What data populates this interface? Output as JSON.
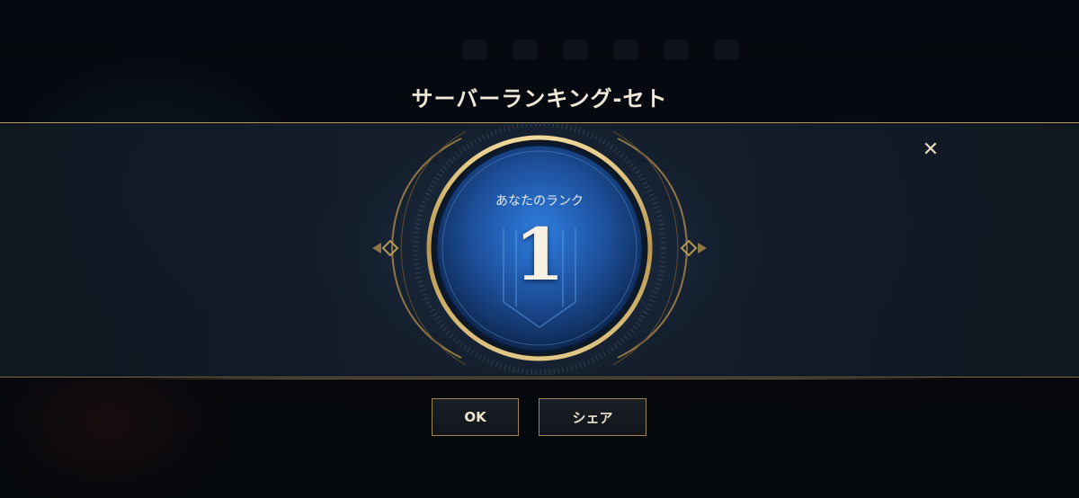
{
  "dialog": {
    "title": "サーバーランキング-セト",
    "rank_label": "あなたのランク",
    "rank_value": "1",
    "close_icon": "close-icon"
  },
  "buttons": {
    "ok_label": "OK",
    "share_label": "シェア"
  },
  "colors": {
    "gold": "#b59a58",
    "orb_blue": "#2a6fd0",
    "text_light": "#f0e9d8"
  }
}
